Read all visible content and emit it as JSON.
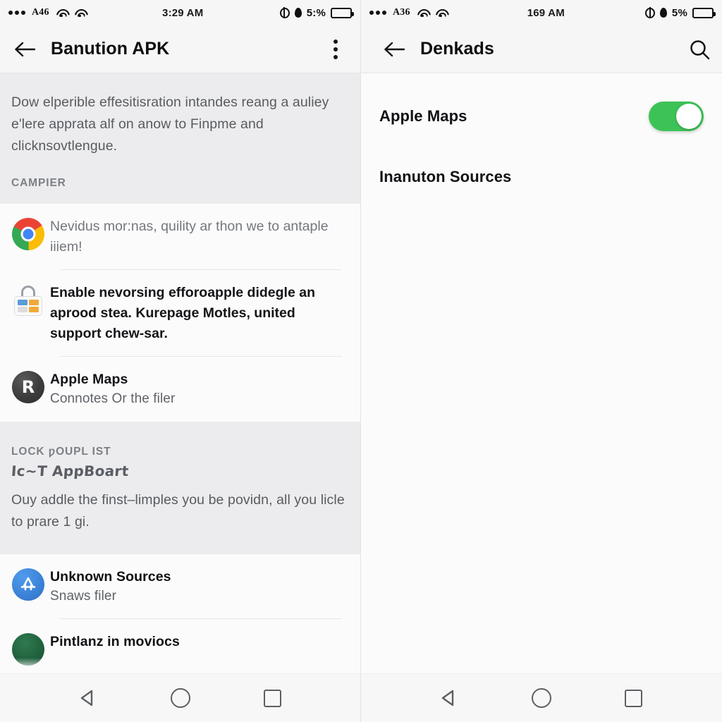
{
  "left": {
    "status_bar": {
      "signal_dots": "•••",
      "carrier": "A46",
      "wifi_icon_1": "wifi-icon",
      "wifi_icon_2": "wifi-icon",
      "time": "3:29 AM",
      "globe_icon": "globe-icon",
      "drop_icon": "water-drop-icon",
      "battery_percent": "5:%",
      "battery_icon": "battery-icon"
    },
    "app_bar": {
      "back_icon": "back-arrow-icon",
      "title": "Banution APK",
      "overflow_icon": "overflow-menu-icon"
    },
    "note": {
      "paragraph": "Dow elperible effesitisration intandes reang a auliey e'lere apprata alf on anow to Finpme and clicknsovtlengue.",
      "caption": "CAMPIER"
    },
    "items": [
      {
        "icon": "chrome-icon",
        "body": "Nevidus mor:nas, quility ar thon we to antaple iiiem!",
        "style": "muted"
      },
      {
        "icon": "play-store-lock-icon",
        "body": "Enable nevorsing efforoapple didegle an aprood stea. Kurepage Motles, united support chew-sar.",
        "style": "bold"
      },
      {
        "icon": "letter-r-avatar-icon",
        "title": "Apple Maps",
        "subtitle": "Connotes Or the filer"
      }
    ],
    "note2": {
      "caption": "LOCK ƿOUPL IST",
      "handwriting": "Ic~T AppBoart",
      "paragraph": "Ouy addle the finst–limples you be povidn, all you licle to prare 1 gi."
    },
    "items2": [
      {
        "icon": "app-store-icon",
        "title": "Unknown Sources",
        "subtitle": "Snaws filer"
      },
      {
        "icon": "green-circle-icon",
        "title": "Pintlanz in moviocs"
      }
    ]
  },
  "right": {
    "status_bar": {
      "signal_dots": "•••",
      "carrier": "A36",
      "wifi_icon_1": "wifi-icon",
      "wifi_icon_2": "wifi-icon",
      "time": "169 AM",
      "globe_icon": "globe-icon",
      "drop_icon": "water-drop-icon",
      "battery_percent": "5%",
      "battery_icon": "battery-icon"
    },
    "app_bar": {
      "back_icon": "back-arrow-icon",
      "title": "Denkads",
      "search_icon": "search-icon"
    },
    "rows": [
      {
        "label": "Apple Maps",
        "toggle": "on"
      },
      {
        "label": "Inanuton Sources"
      }
    ]
  },
  "nav_bar": {
    "back_icon": "nav-back-triangle-icon",
    "home_icon": "nav-home-circle-icon",
    "recents_icon": "nav-recents-square-icon"
  },
  "colors": {
    "toggle_on": "#3cc356",
    "note_bg": "#ececee",
    "panel_bg": "#fbfbfb",
    "bar_bg": "#f6f6f6"
  }
}
